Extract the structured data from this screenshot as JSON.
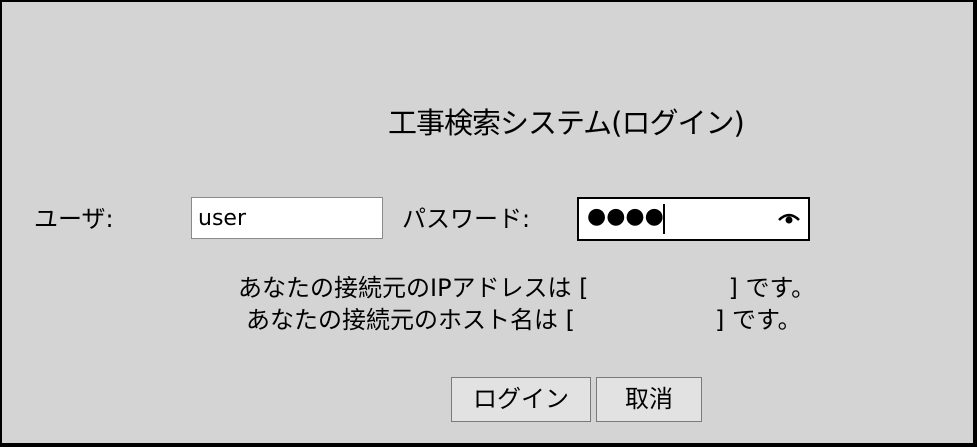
{
  "title": "工事検索システム(ログイン)",
  "form": {
    "user_label": "ユーザ:",
    "user_value": "user",
    "password_label": "パスワード:",
    "password_masked": "●●●●"
  },
  "info": {
    "ip_prefix": "あなたの接続元のIPアドレスは [",
    "ip_suffix": "] です。",
    "host_prefix": "あなたの接続元のホスト名は [",
    "host_suffix": "] です。"
  },
  "buttons": {
    "login_label": "ログイン",
    "cancel_label": "取消"
  },
  "icons": {
    "password_reveal": "eye-icon"
  },
  "colors": {
    "panel_background": "#d4d4d4",
    "frame": "#000000",
    "button_background": "#e2e2e2"
  }
}
